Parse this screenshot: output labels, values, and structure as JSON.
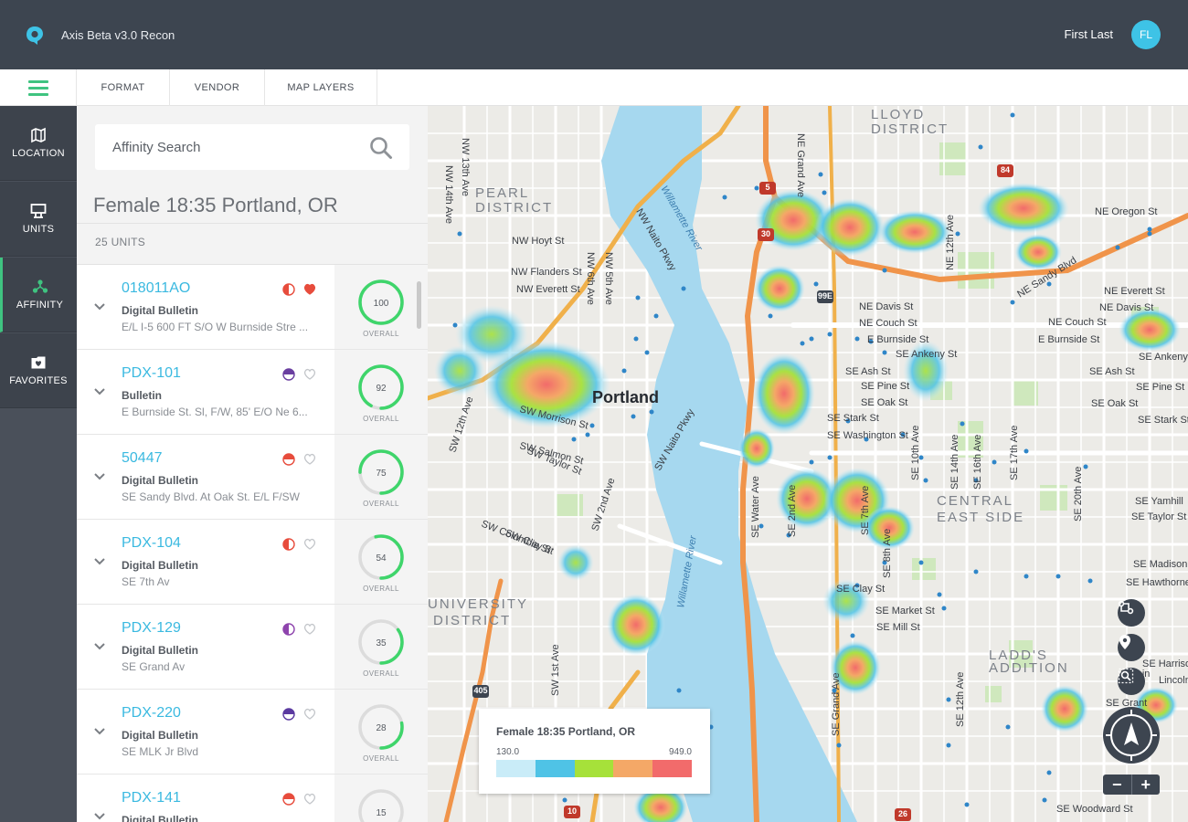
{
  "app": {
    "title": "Axis Beta v3.0 Recon",
    "user_name": "First Last",
    "user_initials": "FL"
  },
  "toolbar": {
    "tabs": [
      "FORMAT",
      "VENDOR",
      "MAP LAYERS"
    ]
  },
  "nav": {
    "items": [
      {
        "label": "LOCATION",
        "icon": "map-icon"
      },
      {
        "label": "UNITS",
        "icon": "billboard-icon"
      },
      {
        "label": "AFFINITY",
        "icon": "network-icon",
        "active": true
      },
      {
        "label": "FAVORITES",
        "icon": "folder-heart-icon"
      }
    ]
  },
  "search": {
    "placeholder": "Affinity Search"
  },
  "results": {
    "title": "Female 18:35 Portland, OR",
    "count": "25 UNITS",
    "score_label": "OVERALL"
  },
  "units": [
    {
      "id": "018011AO",
      "type": "Digital Bulletin",
      "address": "E/L I-5 600 FT S/O W Burnside Stre ...",
      "score": 100,
      "status_color": "#e74c3c",
      "status_icon": "half-circle-icon",
      "favorite": true
    },
    {
      "id": "PDX-101",
      "type": "Bulletin",
      "address": "E Burnside St. Sl, F/W, 85' E/O Ne 6...",
      "score": 92,
      "status_color": "#6a3fa0",
      "status_icon": "pie-icon",
      "favorite": false
    },
    {
      "id": "50447",
      "type": "Digital Bulletin",
      "address": "SE Sandy Blvd. At Oak St. E/L F/SW",
      "score": 75,
      "status_color": "#e74c3c",
      "status_icon": "pie-icon",
      "favorite": false
    },
    {
      "id": "PDX-104",
      "type": "Digital Bulletin",
      "address": "SE 7th Av",
      "score": 54,
      "status_color": "#e74c3c",
      "status_icon": "half-circle-icon",
      "favorite": false
    },
    {
      "id": "PDX-129",
      "type": "Digital Bulletin",
      "address": "SE Grand Av",
      "score": 35,
      "status_color": "#8e44ad",
      "status_icon": "half-circle-icon",
      "favorite": false
    },
    {
      "id": "PDX-220",
      "type": "Digital Bulletin",
      "address": "SE MLK Jr Blvd",
      "score": 28,
      "status_color": "#5b3aa0",
      "status_icon": "pie-icon",
      "favorite": false
    },
    {
      "id": "PDX-141",
      "type": "Digital Bulletin",
      "address": "",
      "score": 15,
      "status_color": "#e74c3c",
      "status_icon": "pie-icon",
      "favorite": false
    }
  ],
  "legend": {
    "title": "Female 18:35 Portland, OR",
    "min": "130.0",
    "max": "949.0",
    "colors": [
      "#c9ecf8",
      "#4fc3e6",
      "#a6e13a",
      "#f4a867",
      "#f26b6b"
    ]
  },
  "map": {
    "labels": [
      {
        "text": "LLOYD",
        "kind": "district"
      },
      {
        "text": "DISTRICT",
        "kind": "district"
      },
      {
        "text": "PEARL",
        "kind": "district"
      },
      {
        "text": "DISTRICT",
        "kind": "district"
      },
      {
        "text": "CENTRAL",
        "kind": "district"
      },
      {
        "text": "EAST SIDE",
        "kind": "district"
      },
      {
        "text": "UNIVERSITY",
        "kind": "district"
      },
      {
        "text": "DISTRICT",
        "kind": "district"
      },
      {
        "text": "LADD'S",
        "kind": "district"
      },
      {
        "text": "ADDITION",
        "kind": "district"
      },
      {
        "text": "Portland",
        "kind": "city"
      },
      {
        "text": "NW Hoyt St",
        "kind": "street"
      },
      {
        "text": "NW Flanders St",
        "kind": "street"
      },
      {
        "text": "NW Everett St",
        "kind": "street"
      },
      {
        "text": "NE Davis St",
        "kind": "street"
      },
      {
        "text": "NE Couch St",
        "kind": "street"
      },
      {
        "text": "E Burnside St",
        "kind": "street"
      },
      {
        "text": "SE Ankeny St",
        "kind": "street"
      },
      {
        "text": "SE Ash St",
        "kind": "street"
      },
      {
        "text": "SE Pine St",
        "kind": "street"
      },
      {
        "text": "SE Oak St",
        "kind": "street"
      },
      {
        "text": "SE Stark St",
        "kind": "street"
      },
      {
        "text": "SE Washington St",
        "kind": "street"
      },
      {
        "text": "NE Oregon St",
        "kind": "street"
      },
      {
        "text": "NE Sandy Blvd",
        "kind": "street"
      },
      {
        "text": "NE Everett St",
        "kind": "street"
      },
      {
        "text": "NE Davis St",
        "kind": "street"
      },
      {
        "text": "NE Couch St",
        "kind": "street"
      },
      {
        "text": "E Burnside St",
        "kind": "street"
      },
      {
        "text": "SE Ankeny",
        "kind": "street"
      },
      {
        "text": "SE Ash St",
        "kind": "street"
      },
      {
        "text": "SE Pine St",
        "kind": "street"
      },
      {
        "text": "SE Oak St",
        "kind": "street"
      },
      {
        "text": "SE Stark St",
        "kind": "street"
      },
      {
        "text": "SE Yamhill",
        "kind": "street"
      },
      {
        "text": "SE Taylor St",
        "kind": "street"
      },
      {
        "text": "SE Madison",
        "kind": "street"
      },
      {
        "text": "SE Hawthorne Bl",
        "kind": "street"
      },
      {
        "text": "SE Clay St",
        "kind": "street"
      },
      {
        "text": "SE Market St",
        "kind": "street"
      },
      {
        "text": "SE Mill St",
        "kind": "street"
      },
      {
        "text": "SE Harrison",
        "kind": "street"
      },
      {
        "text": "Lincoln St",
        "kind": "street"
      },
      {
        "text": "SE Woodward St",
        "kind": "street"
      },
      {
        "text": "SW Morrison St",
        "kind": "street"
      },
      {
        "text": "SW Salmon St",
        "kind": "street"
      },
      {
        "text": "SW Taylor St",
        "kind": "street"
      },
      {
        "text": "SW Columbia St",
        "kind": "street"
      },
      {
        "text": "SW Clay St",
        "kind": "street"
      },
      {
        "text": "SW 12th Ave",
        "kind": "street"
      },
      {
        "text": "SW 2nd Ave",
        "kind": "street"
      },
      {
        "text": "SW Naito Pkwy",
        "kind": "street"
      },
      {
        "text": "SW 1st Ave",
        "kind": "street"
      },
      {
        "text": "NW 13th Ave",
        "kind": "street"
      },
      {
        "text": "NW 14th Ave",
        "kind": "street"
      },
      {
        "text": "NW 6th Ave",
        "kind": "street"
      },
      {
        "text": "NW 5th Ave",
        "kind": "street"
      },
      {
        "text": "NW Naito Pkwy",
        "kind": "street"
      },
      {
        "text": "NE Grand Ave",
        "kind": "street"
      },
      {
        "text": "NE 12th Ave",
        "kind": "street"
      },
      {
        "text": "SE Water Ave",
        "kind": "street"
      },
      {
        "text": "SE 2nd Ave",
        "kind": "street"
      },
      {
        "text": "SE 7th Ave",
        "kind": "street"
      },
      {
        "text": "SE 8th Ave",
        "kind": "street"
      },
      {
        "text": "SE 10th Ave",
        "kind": "street"
      },
      {
        "text": "SE 14th Ave",
        "kind": "street"
      },
      {
        "text": "SE 16th Ave",
        "kind": "street"
      },
      {
        "text": "SE 17th Ave",
        "kind": "street"
      },
      {
        "text": "SE 20th Ave",
        "kind": "street"
      },
      {
        "text": "SE 12th Ave",
        "kind": "street"
      },
      {
        "text": "SE Grand Ave",
        "kind": "street"
      },
      {
        "text": "Willamette River",
        "kind": "water"
      },
      {
        "text": "Willamette River",
        "kind": "water"
      },
      {
        "text": "5",
        "kind": "shield"
      },
      {
        "text": "84",
        "kind": "shield"
      },
      {
        "text": "30",
        "kind": "shield"
      },
      {
        "text": "99E",
        "kind": "shield"
      },
      {
        "text": "405",
        "kind": "shield"
      },
      {
        "text": "10",
        "kind": "shield"
      },
      {
        "text": "26",
        "kind": "shield"
      },
      {
        "text": "SE Grant",
        "kind": "street"
      },
      {
        "text": "SE Lin",
        "kind": "street"
      }
    ]
  }
}
